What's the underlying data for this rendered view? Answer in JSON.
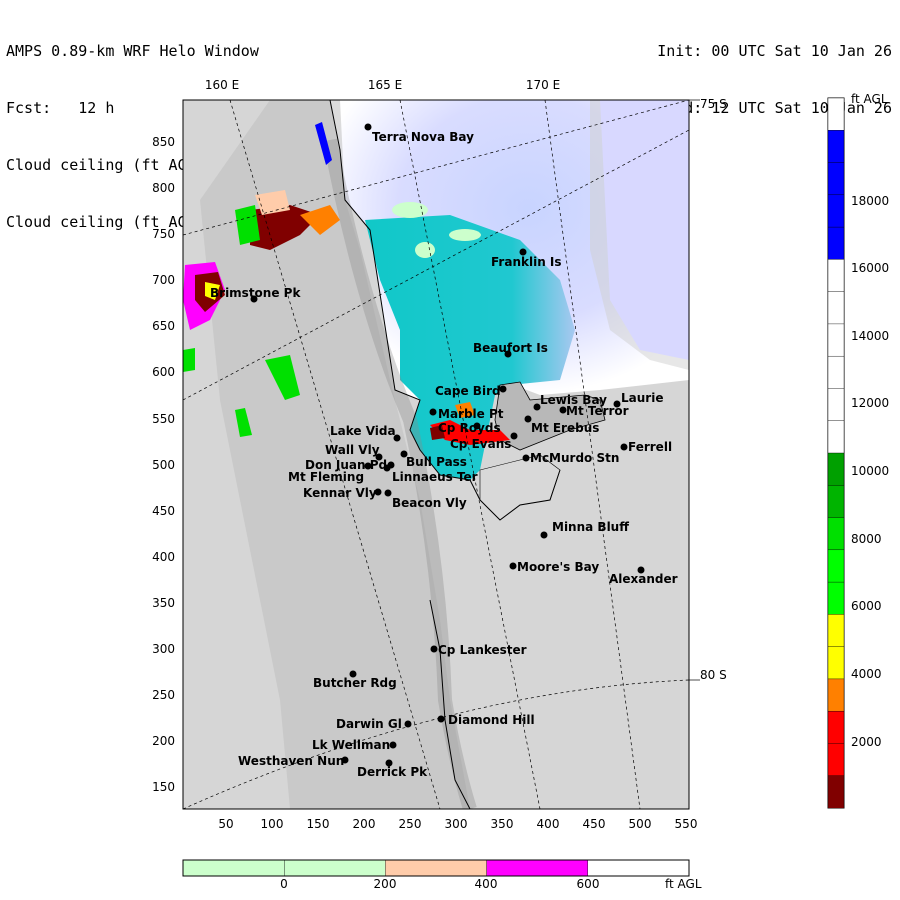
{
  "header": {
    "title": "AMPS 0.89-km WRF Helo Window",
    "forecast": "Fcst:   12 h",
    "variable_line_1": "Cloud ceiling (ft AGL)",
    "variable_line_2": "Cloud ceiling (ft AGL)",
    "init": "Init: 00 UTC Sat 10 Jan 26",
    "valid": "Valid: 12 UTC Sat 10 Jan 26"
  },
  "map": {
    "longitude_labels": [
      "160 E",
      "165 E",
      "170 E"
    ],
    "latitude_labels": [
      "75 S",
      "80 S"
    ],
    "x_ticks": [
      "50",
      "100",
      "150",
      "200",
      "250",
      "300",
      "350",
      "400",
      "450",
      "500",
      "550"
    ],
    "y_ticks": [
      "850",
      "800",
      "750",
      "700",
      "650",
      "600",
      "550",
      "500",
      "450",
      "400",
      "350",
      "300",
      "250",
      "200",
      "150"
    ],
    "stations": [
      {
        "name": "Terra Nova Bay"
      },
      {
        "name": "Franklin Is"
      },
      {
        "name": "Brimstone Pk"
      },
      {
        "name": "Beaufort Is"
      },
      {
        "name": "Cape Bird"
      },
      {
        "name": "Lewis Bay"
      },
      {
        "name": "Laurie"
      },
      {
        "name": "Mt Terror"
      },
      {
        "name": "Marble Pt"
      },
      {
        "name": "Cp Royds"
      },
      {
        "name": "Mt Erebus"
      },
      {
        "name": "Cp Evans"
      },
      {
        "name": "Lake Vida"
      },
      {
        "name": "Ferrell"
      },
      {
        "name": "Wall Vly"
      },
      {
        "name": "Bull Pass"
      },
      {
        "name": "McMurdo Stn"
      },
      {
        "name": "Don Juan Pd"
      },
      {
        "name": "Mt Fleming"
      },
      {
        "name": "Linnaeus Ter"
      },
      {
        "name": "Kennar Vly"
      },
      {
        "name": "Beacon Vly"
      },
      {
        "name": "Minna Bluff"
      },
      {
        "name": "Moore's Bay"
      },
      {
        "name": "Alexander"
      },
      {
        "name": "Cp Lankester"
      },
      {
        "name": "Butcher Rdg"
      },
      {
        "name": "Darwin Gl"
      },
      {
        "name": "Diamond Hill"
      },
      {
        "name": "Lk Wellman"
      },
      {
        "name": "Westhaven Nun"
      },
      {
        "name": "Derrick Pk"
      }
    ]
  },
  "colorbar_vertical": {
    "units": "ft AGL",
    "labels": [
      "18000",
      "16000",
      "14000",
      "12000",
      "10000",
      "8000",
      "6000",
      "4000",
      "2000"
    ],
    "colors": [
      "#ffffff",
      "#0000ff",
      "#0000ff",
      "#0000ff",
      "#0000ff",
      "#ffffff",
      "#ffffff",
      "#ffffff",
      "#ffffff",
      "#ffffff",
      "#ffffff",
      "#00a000",
      "#00b400",
      "#00e000",
      "#00ff00",
      "#00ff00",
      "#ffff00",
      "#ffff00",
      "#ff8000",
      "#ff0000",
      "#ff0000",
      "#800000"
    ]
  },
  "colorbar_horizontal": {
    "units": "ft AGL",
    "labels": [
      "0",
      "200",
      "400",
      "600"
    ],
    "colors": [
      "#ccffcc",
      "#ccffcc",
      "#ffccaa",
      "#ff00ff",
      "#ffffff"
    ]
  }
}
